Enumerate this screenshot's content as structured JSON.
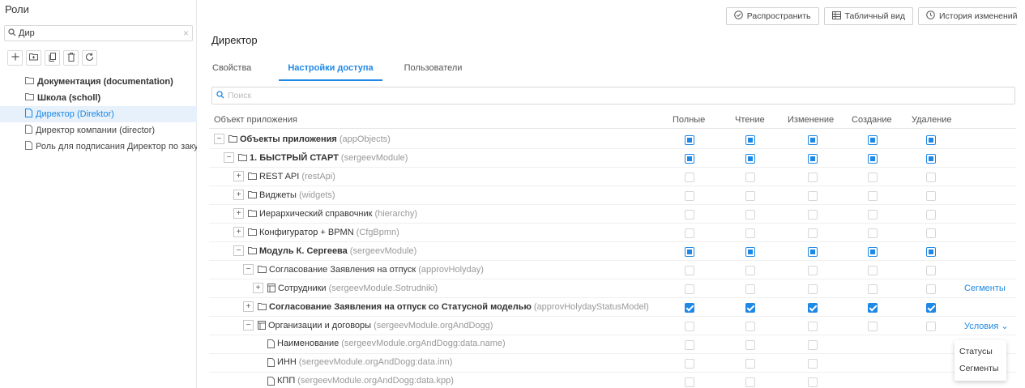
{
  "sidebar": {
    "title": "Роли",
    "search_value": "Дир",
    "search_clear": "×",
    "tree": [
      {
        "label": "Документация (documentation)",
        "icon": "folder-icon",
        "bold": true,
        "selected": false
      },
      {
        "label": "Школа (scholl)",
        "icon": "folder-icon",
        "bold": true,
        "selected": false
      },
      {
        "label": "Директор (Direktor)",
        "icon": "document-icon",
        "bold": false,
        "selected": true
      },
      {
        "label": "Директор компании (director)",
        "icon": "document-icon",
        "bold": false,
        "selected": false
      },
      {
        "label": "Роль для подписания Директор по закупкам",
        "icon": "document-icon",
        "bold": false,
        "selected": false
      }
    ]
  },
  "top_buttons": {
    "distribute": "Распространить",
    "table_view": "Табличный вид",
    "history": "История изменений"
  },
  "main": {
    "title": "Директор",
    "tabs": [
      "Свойства",
      "Настройки доступа",
      "Пользователи"
    ],
    "active_tab": 1,
    "search_placeholder": "Поиск"
  },
  "table": {
    "headers": {
      "object": "Объект приложения",
      "full": "Полные",
      "read": "Чтение",
      "edit": "Изменение",
      "create": "Создание",
      "delete": "Удаление"
    },
    "rows": [
      {
        "indent": 0,
        "expander": "−",
        "icon": "folder-icon",
        "name": "Объекты приложения",
        "sys": "(appObjects)",
        "bold": true,
        "checks": [
          "partial",
          "partial",
          "partial",
          "partial",
          "partial"
        ]
      },
      {
        "indent": 1,
        "expander": "−",
        "icon": "folder-icon",
        "name": "1. БЫСТРЫЙ СТАРТ",
        "sys": "(sergeevModule)",
        "bold": true,
        "checks": [
          "partial",
          "partial",
          "partial",
          "partial",
          "partial"
        ]
      },
      {
        "indent": 2,
        "expander": "+",
        "icon": "folder-icon",
        "name": "REST API",
        "sys": "(restApi)",
        "bold": false,
        "checks": [
          "empty",
          "empty",
          "empty",
          "empty",
          "empty"
        ]
      },
      {
        "indent": 2,
        "expander": "+",
        "icon": "folder-icon",
        "name": "Виджеты",
        "sys": "(widgets)",
        "bold": false,
        "checks": [
          "empty",
          "empty",
          "empty",
          "empty",
          "empty"
        ]
      },
      {
        "indent": 2,
        "expander": "+",
        "icon": "folder-icon",
        "name": "Иерархический справочник",
        "sys": "(hierarchy)",
        "bold": false,
        "checks": [
          "empty",
          "empty",
          "empty",
          "empty",
          "empty"
        ]
      },
      {
        "indent": 2,
        "expander": "+",
        "icon": "folder-icon",
        "name": "Конфигуратор + BPMN",
        "sys": "(CfgBpmn)",
        "bold": false,
        "checks": [
          "empty",
          "empty",
          "empty",
          "empty",
          "empty"
        ]
      },
      {
        "indent": 2,
        "expander": "−",
        "icon": "folder-icon",
        "name": "Модуль К. Сергеева",
        "sys": "(sergeevModule)",
        "bold": true,
        "checks": [
          "partial",
          "partial",
          "partial",
          "partial",
          "partial"
        ]
      },
      {
        "indent": 3,
        "expander": "−",
        "icon": "folder-icon",
        "name": "Согласование Заявления на отпуск",
        "sys": "(approvHolyday)",
        "bold": false,
        "checks": [
          "empty",
          "empty",
          "empty",
          "empty",
          "empty"
        ]
      },
      {
        "indent": 4,
        "expander": "+",
        "icon": "table-icon",
        "name": "Сотрудники",
        "sys": "(sergeevModule.Sotrudniki)",
        "bold": false,
        "checks": [
          "empty",
          "empty",
          "empty",
          "empty",
          "empty"
        ],
        "link": "Сегменты"
      },
      {
        "indent": 3,
        "expander": "+",
        "icon": "folder-icon",
        "name": "Согласование Заявления на отпуск со Статусной моделью",
        "sys": "(approvHolydayStatusModel)",
        "bold": true,
        "checks": [
          "checked",
          "checked",
          "checked",
          "checked",
          "checked"
        ]
      },
      {
        "indent": 3,
        "expander": "−",
        "icon": "table-icon",
        "name": "Организации и договоры",
        "sys": "(sergeevModule.orgAndDogg)",
        "bold": false,
        "checks": [
          "empty",
          "empty",
          "empty",
          "empty",
          "empty"
        ],
        "link": "Условия ⌄"
      },
      {
        "indent": 4,
        "expander": "",
        "icon": "document-icon",
        "name": "Наименование",
        "sys": "(sergeevModule.orgAndDogg:data.name)",
        "bold": false,
        "checks": [
          "empty",
          "empty",
          "empty"
        ]
      },
      {
        "indent": 4,
        "expander": "",
        "icon": "document-icon",
        "name": "ИНН",
        "sys": "(sergeevModule.orgAndDogg:data.inn)",
        "bold": false,
        "checks": [
          "empty",
          "empty",
          "empty"
        ]
      },
      {
        "indent": 4,
        "expander": "",
        "icon": "document-icon",
        "name": "КПП",
        "sys": "(sergeevModule.orgAndDogg:data.kpp)",
        "bold": false,
        "checks": [
          "empty",
          "empty",
          "empty"
        ]
      }
    ]
  },
  "dropdown": {
    "items": [
      "Статусы",
      "Сегменты"
    ]
  }
}
